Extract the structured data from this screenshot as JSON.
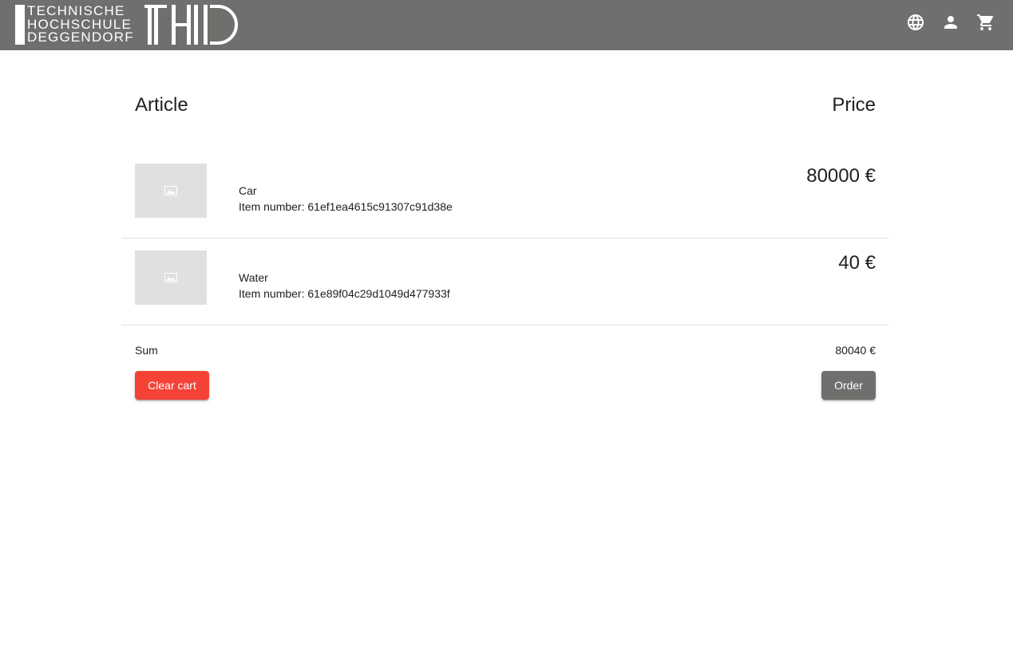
{
  "header": {
    "logo_lines": [
      "TECHNISCHE",
      "HOCHSCHULE",
      "DEGGENDORF"
    ],
    "logo_mark": "THD",
    "icons": [
      "language-icon",
      "person-icon",
      "shopping-cart-icon"
    ],
    "background_color": "#6f6f6d"
  },
  "cart": {
    "column_article": "Article",
    "column_price": "Price",
    "items": [
      {
        "name": "Car",
        "item_number": "Item number: 61ef1ea4615c91307c91d38e",
        "price": "80000 €",
        "image_icon": "image-placeholder-icon"
      },
      {
        "name": "Water",
        "item_number": "Item number: 61e89f04c29d1049d477933f",
        "price": "40 €",
        "image_icon": "image-placeholder-icon"
      }
    ],
    "sum_label": "Sum",
    "sum_value": "80040 €",
    "clear_button": "Clear cart",
    "order_button": "Order",
    "clear_button_color": "#f44336",
    "order_button_color": "#6f6f6d"
  }
}
